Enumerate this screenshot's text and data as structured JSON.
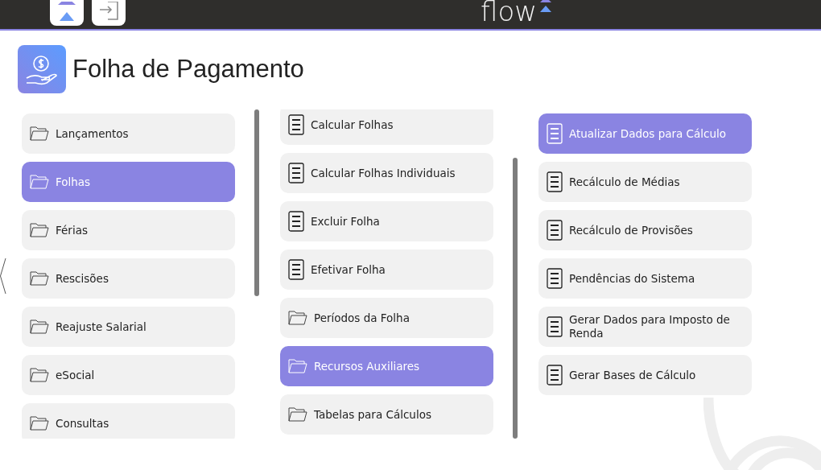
{
  "header": {
    "logo": "flow"
  },
  "page": {
    "title": "Folha de Pagamento"
  },
  "columns": [
    {
      "items": [
        {
          "label": "Lançamentos",
          "kind": "folder",
          "selected": false
        },
        {
          "label": "Folhas",
          "kind": "folder",
          "selected": true
        },
        {
          "label": "Férias",
          "kind": "folder",
          "selected": false
        },
        {
          "label": "Rescisões",
          "kind": "folder",
          "selected": false
        },
        {
          "label": "Reajuste Salarial",
          "kind": "folder",
          "selected": false
        },
        {
          "label": "eSocial",
          "kind": "folder",
          "selected": false
        },
        {
          "label": "Consultas",
          "kind": "folder",
          "selected": false
        }
      ]
    },
    {
      "items": [
        {
          "label": "Calcular Folhas",
          "kind": "document",
          "selected": false
        },
        {
          "label": "Calcular Folhas Individuais",
          "kind": "document",
          "selected": false
        },
        {
          "label": "Excluir Folha",
          "kind": "document",
          "selected": false
        },
        {
          "label": "Efetivar Folha",
          "kind": "document",
          "selected": false
        },
        {
          "label": "Períodos da Folha",
          "kind": "folder",
          "selected": false
        },
        {
          "label": "Recursos Auxiliares",
          "kind": "folder",
          "selected": true
        },
        {
          "label": "Tabelas para Cálculos",
          "kind": "folder",
          "selected": false
        }
      ]
    },
    {
      "items": [
        {
          "label": "Atualizar Dados para Cálculo",
          "kind": "document",
          "selected": true
        },
        {
          "label": "Recálculo de Médias",
          "kind": "document",
          "selected": false
        },
        {
          "label": "Recálculo de Provisões",
          "kind": "document",
          "selected": false
        },
        {
          "label": "Pendências do Sistema",
          "kind": "document",
          "selected": false
        },
        {
          "label": "Gerar Dados para Imposto de Renda",
          "kind": "document",
          "selected": false
        },
        {
          "label": "Gerar Bases de Cálculo",
          "kind": "document",
          "selected": false
        }
      ]
    }
  ]
}
